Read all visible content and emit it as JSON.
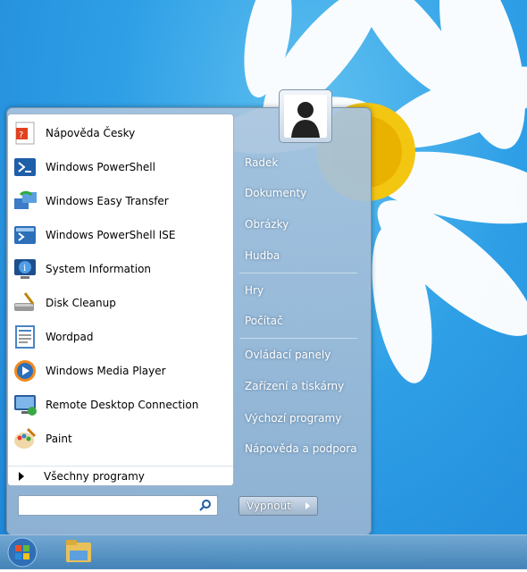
{
  "start_menu": {
    "programs": [
      {
        "label": "Nápověda Česky",
        "icon": "help-book-icon"
      },
      {
        "label": "Windows PowerShell",
        "icon": "powershell-icon"
      },
      {
        "label": "Windows Easy Transfer",
        "icon": "easy-transfer-icon"
      },
      {
        "label": "Windows PowerShell ISE",
        "icon": "powershell-ise-icon"
      },
      {
        "label": "System Information",
        "icon": "system-information-icon"
      },
      {
        "label": "Disk Cleanup",
        "icon": "disk-cleanup-icon"
      },
      {
        "label": "Wordpad",
        "icon": "wordpad-icon"
      },
      {
        "label": "Windows Media Player",
        "icon": "media-player-icon"
      },
      {
        "label": "Remote Desktop Connection",
        "icon": "remote-desktop-icon"
      },
      {
        "label": "Paint",
        "icon": "paint-icon"
      }
    ],
    "all_programs_label": "Všechny programy",
    "search_placeholder": "",
    "right_items": [
      "Radek",
      "Dokumenty",
      "Obrázky",
      "Hudba",
      "Hry",
      "Počítač",
      "Ovládací panely",
      "Zařízení a tiskárny",
      "Výchozí programy",
      "Nápověda a podpora"
    ],
    "shutdown_label": "Vypnout"
  },
  "taskbar": {
    "items": [
      {
        "icon": "start-orb-icon"
      },
      {
        "icon": "file-explorer-icon"
      }
    ]
  },
  "colors": {
    "desktop_blue": "#2e9fe6",
    "menu_glass": "#a8c4de",
    "white": "#ffffff"
  }
}
